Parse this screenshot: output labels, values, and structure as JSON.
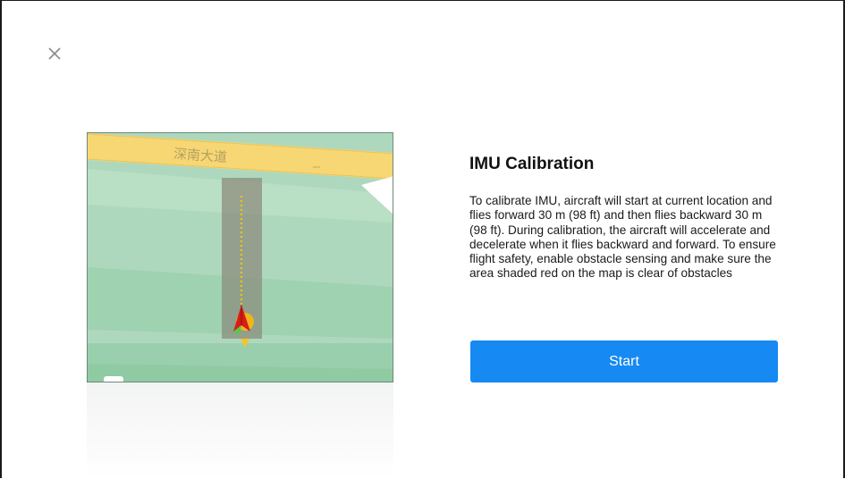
{
  "dialog": {
    "close_icon": "close-icon",
    "title": "IMU Calibration",
    "description": "To calibrate IMU, aircraft will start at current location and flies forward 30 m (98 ft) and then flies backward 30 m (98 ft). During calibration, the aircraft will accelerate and decelerate when it flies backward and forward. To ensure flight safety, enable obstacle sensing and make sure the area shaded red on the map is clear of obstacles",
    "start_label": "Start",
    "accent_color": "#1689f2"
  },
  "map": {
    "road_label": "深南大道",
    "road_color": "#f7d774",
    "land_color": "#aed8bd",
    "aircraft_icon": "aircraft-icon",
    "home_point_icon": "home-point-icon"
  }
}
